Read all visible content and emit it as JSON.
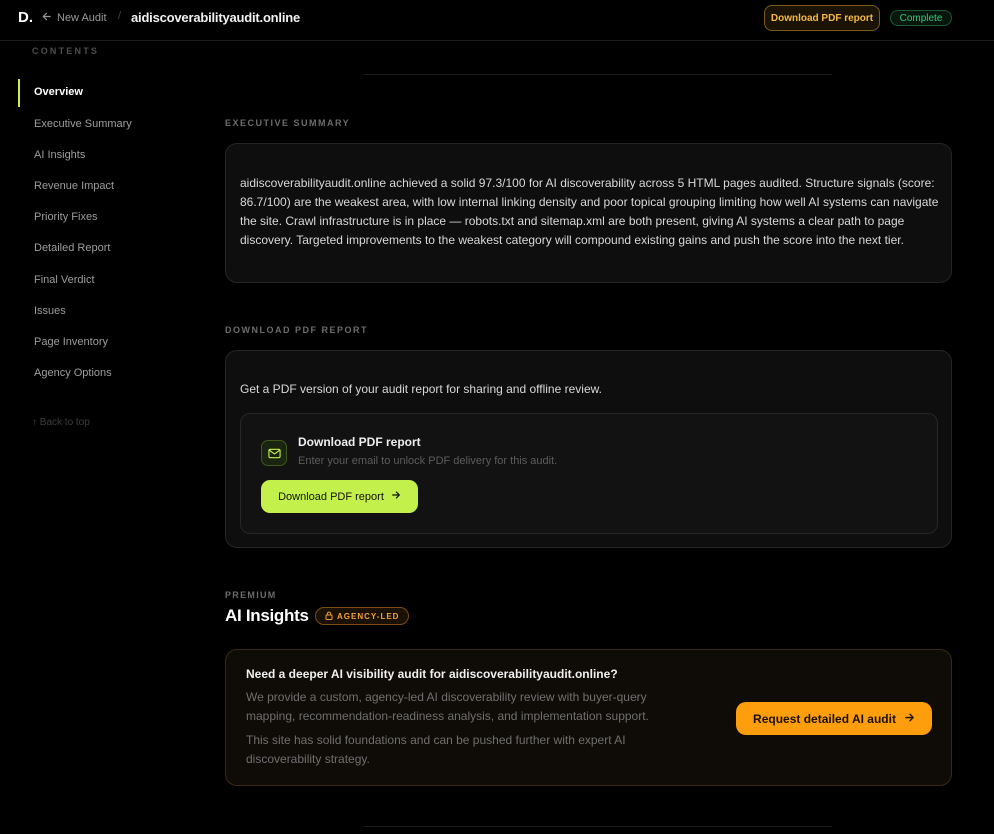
{
  "header": {
    "logo": "D.",
    "back_label": "New Audit",
    "separator": "/",
    "domain": "aidiscoverabilityaudit.online",
    "download_button": "Download PDF report",
    "status_badge": "Complete"
  },
  "sidebar": {
    "heading": "CONTENTS",
    "items": [
      {
        "label": "Overview",
        "active": true
      },
      {
        "label": "Executive Summary"
      },
      {
        "label": "AI Insights"
      },
      {
        "label": "Revenue Impact"
      },
      {
        "label": "Priority Fixes"
      },
      {
        "label": "Detailed Report"
      },
      {
        "label": "Final Verdict"
      },
      {
        "label": "Issues"
      },
      {
        "label": "Page Inventory"
      },
      {
        "label": "Agency Options"
      }
    ],
    "back_to_top": "↑ Back to top"
  },
  "executive_summary": {
    "heading": "EXECUTIVE SUMMARY",
    "text": "aidiscoverabilityaudit.online achieved a solid 97.3/100 for AI discoverability across 5 HTML pages audited. Structure signals (score: 86.7/100) are the weakest area, with low internal linking density and poor topical grouping limiting how well AI systems can navigate the site. Crawl infrastructure is in place — robots.txt and sitemap.xml are both present, giving AI systems a clear path to page discovery. Targeted improvements to the weakest category will compound existing gains and push the score into the next tier."
  },
  "pdf_report": {
    "heading": "DOWNLOAD PDF REPORT",
    "intro": "Get a PDF version of your audit report for sharing and offline review.",
    "card_title": "Download PDF report",
    "card_subtitle": "Enter your email to unlock PDF delivery for this audit.",
    "button_label": "Download PDF report",
    "icon": "mail-icon"
  },
  "ai_insights": {
    "eyebrow": "PREMIUM",
    "title": "AI Insights",
    "badge": "AGENCY-LED",
    "card_title": "Need a deeper AI visibility audit for aidiscoverabilityaudit.online?",
    "paragraph_1": "We provide a custom, agency-led AI discoverability review with buyer-query mapping, recommendation-readiness analysis, and implementation support.",
    "paragraph_2": "This site has solid foundations and can be pushed further with expert AI discoverability strategy.",
    "button_label": "Request detailed AI audit"
  },
  "colors": {
    "accent_lime": "#c3f04a",
    "accent_orange": "#ff9e0d",
    "status_green": "#36c777"
  }
}
